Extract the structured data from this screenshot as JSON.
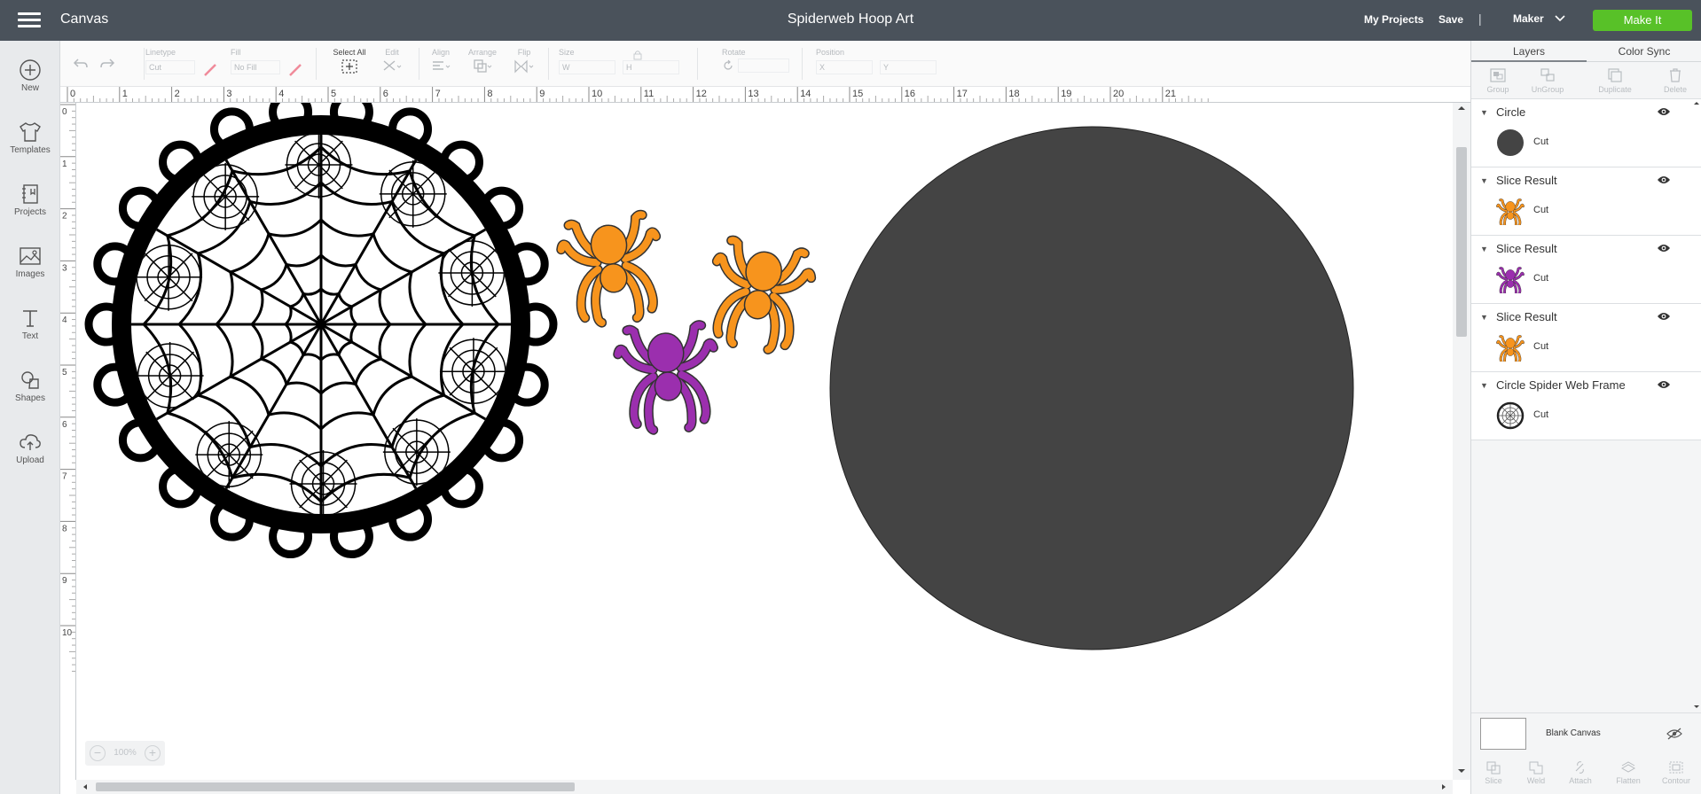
{
  "topbar": {
    "app_name": "Canvas",
    "doc_title": "Spiderweb Hoop Art",
    "my_projects": "My Projects",
    "save": "Save",
    "separator": "|",
    "machine": "Maker",
    "make_it": "Make It"
  },
  "leftbar": {
    "items": [
      {
        "label": "New",
        "icon": "plus-circle-icon"
      },
      {
        "label": "Templates",
        "icon": "tshirt-icon"
      },
      {
        "label": "Projects",
        "icon": "projects-icon"
      },
      {
        "label": "Images",
        "icon": "image-icon"
      },
      {
        "label": "Text",
        "icon": "text-icon"
      },
      {
        "label": "Shapes",
        "icon": "shapes-icon"
      },
      {
        "label": "Upload",
        "icon": "upload-cloud-icon"
      }
    ]
  },
  "edit_toolbar": {
    "linetype_label": "Linetype",
    "linetype_value": "Cut",
    "fill_label": "Fill",
    "fill_value": "No Fill",
    "select_all": "Select All",
    "edit": "Edit",
    "align": "Align",
    "arrange": "Arrange",
    "flip": "Flip",
    "size": "Size",
    "size_w": "W",
    "size_h": "H",
    "rotate": "Rotate",
    "position": "Position",
    "pos_x": "X",
    "pos_y": "Y"
  },
  "rulers": {
    "top": [
      "0",
      "1",
      "2",
      "3",
      "4",
      "5",
      "6",
      "7",
      "8",
      "9",
      "10",
      "11",
      "12",
      "13",
      "14",
      "15",
      "16",
      "17",
      "18",
      "19",
      "20",
      "21"
    ],
    "left": [
      "0",
      "1",
      "2",
      "3",
      "4",
      "5",
      "6",
      "7",
      "8",
      "9",
      "10"
    ]
  },
  "zoom": {
    "value": "100%",
    "minus": "−",
    "plus": "+"
  },
  "colors": {
    "topbar": "#4a525b",
    "make_it": "#58c128",
    "spider_orange": "#f7941d",
    "spider_purple": "#9b2fae",
    "circle_fill": "#444444",
    "web_black": "#000000"
  },
  "right_panel": {
    "tabs": {
      "layers": "Layers",
      "color_sync": "Color Sync"
    },
    "actions": {
      "group": "Group",
      "ungroup": "UnGroup",
      "duplicate": "Duplicate",
      "delete": "Delete"
    },
    "layers": [
      {
        "name": "Circle",
        "op": "Cut",
        "thumb": "circle-thumb-icon"
      },
      {
        "name": "Slice Result",
        "op": "Cut",
        "thumb": "orange-spider-thumb-icon"
      },
      {
        "name": "Slice Result",
        "op": "Cut",
        "thumb": "purple-spider-thumb-icon"
      },
      {
        "name": "Slice Result",
        "op": "Cut",
        "thumb": "orange-spider-thumb-icon"
      },
      {
        "name": "Circle Spider Web Frame",
        "op": "Cut",
        "thumb": "web-frame-thumb-icon"
      }
    ],
    "blank_canvas": "Blank Canvas",
    "bottom_actions": {
      "slice": "Slice",
      "weld": "Weld",
      "attach": "Attach",
      "flatten": "Flatten",
      "contour": "Contour"
    }
  }
}
